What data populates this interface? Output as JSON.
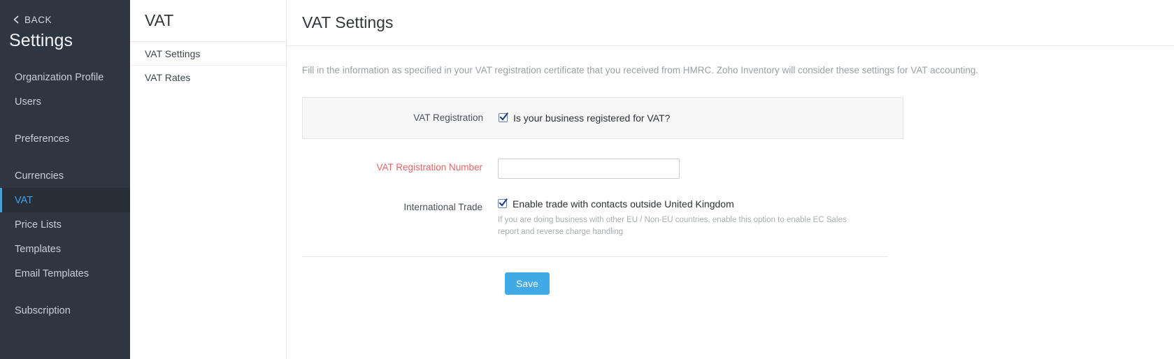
{
  "sidebar": {
    "back_label": "BACK",
    "title": "Settings",
    "items": [
      {
        "label": "Organization Profile",
        "active": false,
        "spaced": false
      },
      {
        "label": "Users",
        "active": false,
        "spaced": false
      },
      {
        "label": "Preferences",
        "active": false,
        "spaced": true
      },
      {
        "label": "Currencies",
        "active": false,
        "spaced": true
      },
      {
        "label": "VAT",
        "active": true,
        "spaced": false
      },
      {
        "label": "Price Lists",
        "active": false,
        "spaced": false
      },
      {
        "label": "Templates",
        "active": false,
        "spaced": false
      },
      {
        "label": "Email Templates",
        "active": false,
        "spaced": false
      },
      {
        "label": "Subscription",
        "active": false,
        "spaced": true
      }
    ]
  },
  "subnav": {
    "header": "VAT",
    "items": [
      {
        "label": "VAT Settings"
      },
      {
        "label": "VAT Rates"
      }
    ]
  },
  "main": {
    "title": "VAT Settings",
    "description": "Fill in the information as specified in your VAT registration certificate that you received from HMRC. Zoho Inventory will consider these settings for VAT accounting.",
    "vat_registration": {
      "label": "VAT Registration",
      "checkbox_label": "Is your business registered for VAT?",
      "checked": true
    },
    "vat_registration_number": {
      "label": "VAT Registration Number",
      "value": "",
      "placeholder": "",
      "required": true
    },
    "international_trade": {
      "label": "International Trade",
      "checkbox_label": "Enable trade with contacts outside United Kingdom",
      "checked": true,
      "help_text": "If you are doing business with other EU / Non-EU countries, enable this option to enable EC Sales report and reverse charge handling"
    },
    "save_label": "Save"
  },
  "colors": {
    "sidebar_bg": "#2e3641",
    "accent": "#3fa2e8",
    "save_button": "#41aae6",
    "required_label": "#e46464",
    "panel_bg": "#f7f7f7"
  }
}
